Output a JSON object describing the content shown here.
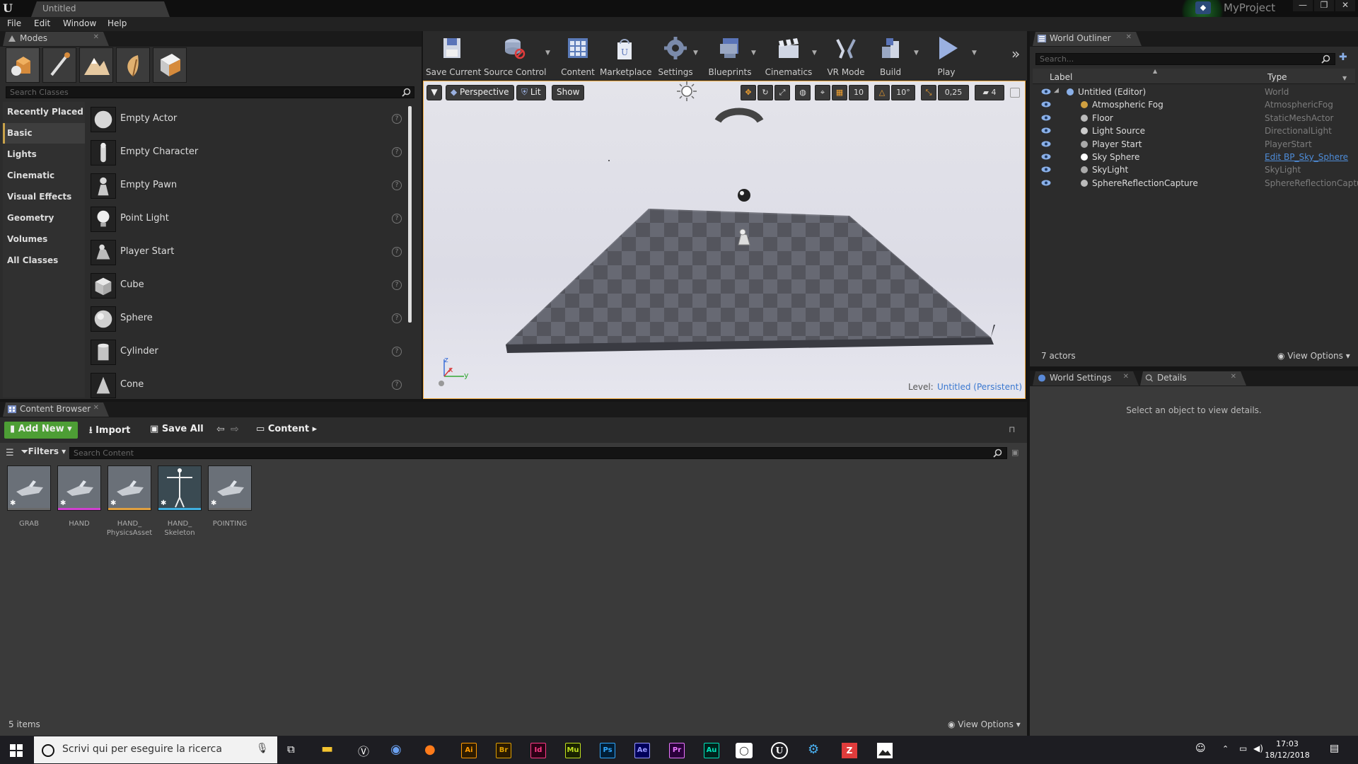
{
  "titlebar": {
    "logo": "U",
    "doc_tab": "Untitled",
    "project": "MyProject",
    "minimize": "—",
    "restore": "❐",
    "close": "✕"
  },
  "menu": [
    "File",
    "Edit",
    "Window",
    "Help"
  ],
  "modes": {
    "tab": "Modes",
    "search_placeholder": "Search Classes",
    "categories": [
      "Recently Placed",
      "Basic",
      "Lights",
      "Cinematic",
      "Visual Effects",
      "Geometry",
      "Volumes",
      "All Classes"
    ],
    "active_category": "Basic",
    "items": [
      "Empty Actor",
      "Empty Character",
      "Empty Pawn",
      "Point Light",
      "Player Start",
      "Cube",
      "Sphere",
      "Cylinder",
      "Cone"
    ]
  },
  "toolbar": [
    "Save Current",
    "Source Control",
    "Content",
    "Marketplace",
    "Settings",
    "Blueprints",
    "Cinematics",
    "VR Mode",
    "Build",
    "Play"
  ],
  "viewport": {
    "perspective": "Perspective",
    "lit": "Lit",
    "show": "Show",
    "grid_snap": "10",
    "rot_snap": "10°",
    "scale_snap": "0,25",
    "cam_speed": "4",
    "level_label": "Level:",
    "level_name": "Untitled (Persistent)",
    "axis_z": "z",
    "axis_x": "x",
    "axis_y": "y"
  },
  "outliner": {
    "tab": "World Outliner",
    "search_placeholder": "Search...",
    "col_label": "Label",
    "col_type": "Type",
    "rows": [
      {
        "label": "Untitled (Editor)",
        "type": "World",
        "indent": 0
      },
      {
        "label": "Atmospheric Fog",
        "type": "AtmosphericFog",
        "indent": 1
      },
      {
        "label": "Floor",
        "type": "StaticMeshActor",
        "indent": 1
      },
      {
        "label": "Light Source",
        "type": "DirectionalLight",
        "indent": 1
      },
      {
        "label": "Player Start",
        "type": "PlayerStart",
        "indent": 1
      },
      {
        "label": "Sky Sphere",
        "type": "Edit BP_Sky_Sphere",
        "indent": 1
      },
      {
        "label": "SkyLight",
        "type": "SkyLight",
        "indent": 1
      },
      {
        "label": "SphereReflectionCapture",
        "type": "SphereReflectionCaptu",
        "indent": 1
      }
    ],
    "count": "7 actors",
    "view_options": "View Options"
  },
  "details": {
    "tab_world_settings": "World Settings",
    "tab_details": "Details",
    "empty_message": "Select an object to view details."
  },
  "content_browser": {
    "tab": "Content Browser",
    "add_new": "Add New",
    "import": "Import",
    "save_all": "Save All",
    "path": "Content",
    "filters": "Filters",
    "search_placeholder": "Search Content",
    "assets": [
      {
        "label": "GRAB",
        "color": "#6a6a6a"
      },
      {
        "label": "HAND",
        "color": "#d040d0"
      },
      {
        "label": "HAND_\nPhysicsAsset",
        "color": "#e0a040"
      },
      {
        "label": "HAND_\nSkeleton",
        "color": "#40b0e0"
      },
      {
        "label": "POINTING",
        "color": "#6a6a6a"
      }
    ],
    "count": "5 items",
    "view_options": "View Options"
  },
  "taskbar": {
    "search_placeholder": "Scrivi qui per eseguire la ricerca",
    "time": "17:03",
    "date": "18/12/2018",
    "apps": [
      {
        "label": "Ai",
        "color": "#ff9a00",
        "bg": "#2d1b00"
      },
      {
        "label": "Br",
        "color": "#e0a000",
        "bg": "#2b1a00"
      },
      {
        "label": "Id",
        "color": "#ff3a86",
        "bg": "#2b0015"
      },
      {
        "label": "Mu",
        "color": "#c0e020",
        "bg": "#1a2200"
      },
      {
        "label": "Ps",
        "color": "#31a8ff",
        "bg": "#001e36"
      },
      {
        "label": "Ae",
        "color": "#9999ff",
        "bg": "#00005b"
      },
      {
        "label": "Pr",
        "color": "#ea77ff",
        "bg": "#2a003a"
      },
      {
        "label": "Au",
        "color": "#00e4bb",
        "bg": "#00221c"
      }
    ]
  }
}
